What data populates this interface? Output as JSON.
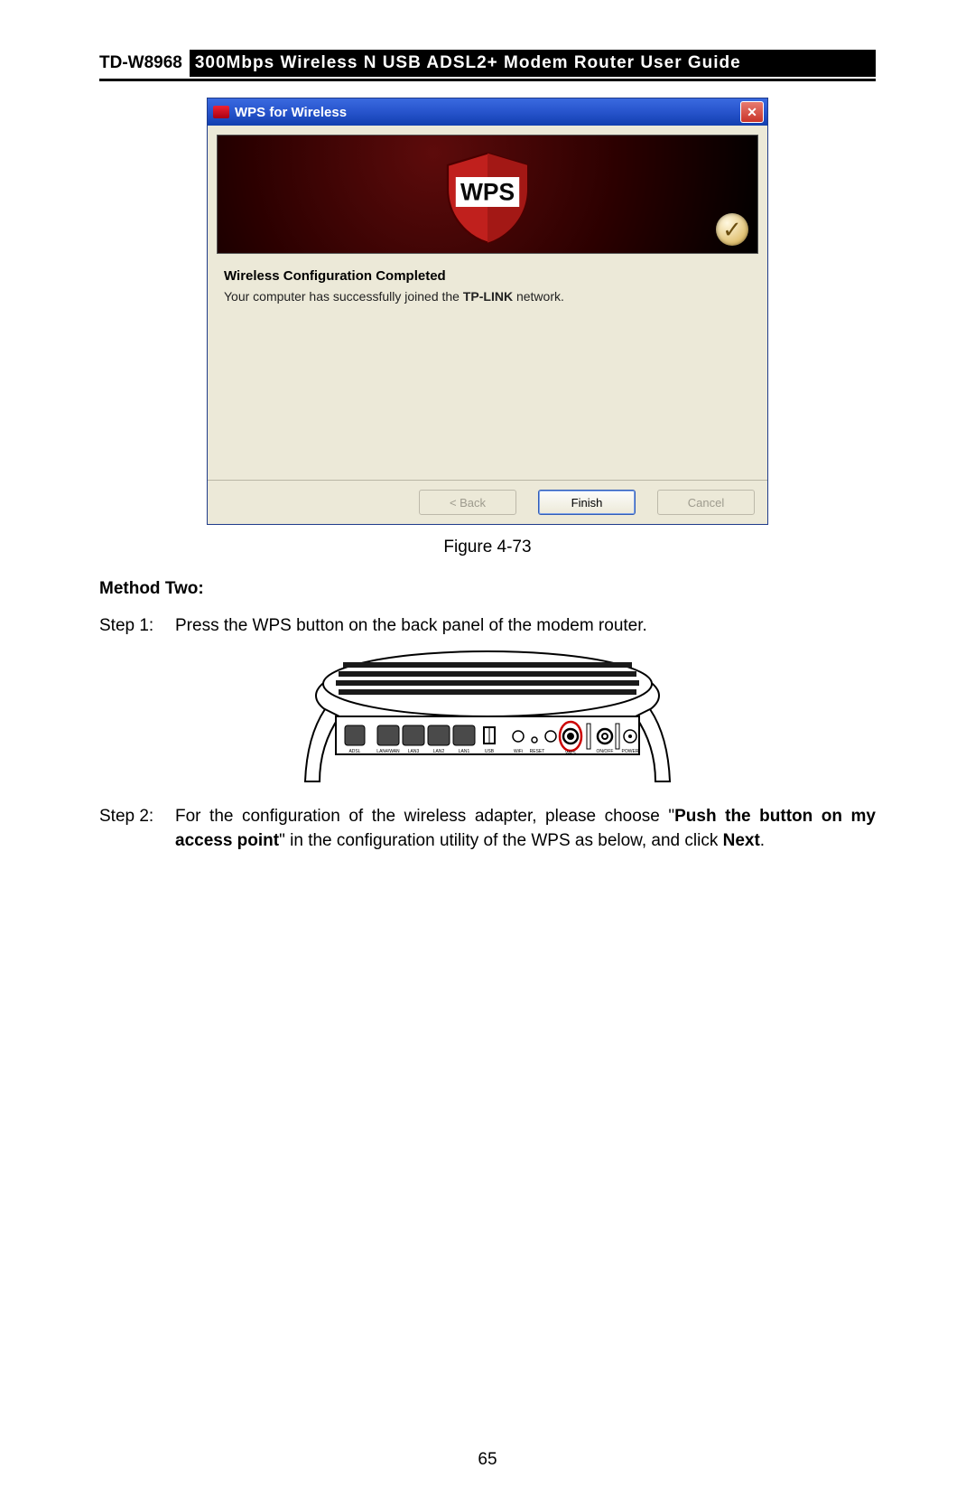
{
  "header": {
    "model": "TD-W8968",
    "title": "300Mbps Wireless N USB ADSL2+ Modem Router User Guide"
  },
  "dialog": {
    "window_title": "WPS for Wireless",
    "shield_text": "WPS",
    "heading": "Wireless Configuration Completed",
    "body_pre": "Your computer has successfully joined the ",
    "body_bold": "TP-LINK",
    "body_post": " network.",
    "btn_back": "< Back",
    "btn_finish": "Finish",
    "btn_cancel": "Cancel",
    "close_glyph": "✕",
    "check_glyph": "✓"
  },
  "figure_caption": "Figure 4-73",
  "method_title": "Method Two:",
  "steps": {
    "s1_label": "Step 1:",
    "s1_text": "Press the WPS button on the back panel of the modem router.",
    "s2_label": "Step 2:",
    "s2_pre": "For the configuration of the wireless adapter, please choose \"",
    "s2_bold1": "Push the button on my access point",
    "s2_mid": "\" in the configuration utility of the WPS as below, and click ",
    "s2_bold2": "Next",
    "s2_post": "."
  },
  "router_labels": {
    "adsl": "ADSL",
    "lan4": "LAN4/WAN",
    "lan3": "LAN3",
    "lan2": "LAN2",
    "lan1": "LAN1",
    "usb": "USB",
    "wifi": "WiFi",
    "reset": "RESET",
    "wps": "WPS",
    "onoff": "ON/OFF",
    "power": "POWER"
  },
  "page_number": "65"
}
